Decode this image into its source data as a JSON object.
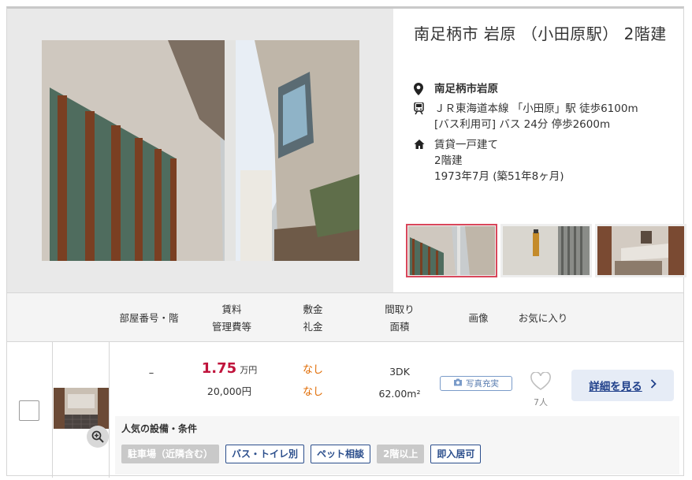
{
  "listing": {
    "title": "南足柄市 岩原 （小田原駅） 2階建",
    "address": "南足柄市岩原",
    "access": [
      "ＪＲ東海道本線 「小田原」駅 徒歩6100m",
      "[バス利用可] バス 24分 停歩2600m"
    ],
    "building": [
      "賃貸一戸建て",
      "2階建",
      "1973年7月 (築51年8ヶ月)"
    ],
    "icons": {
      "address": "map-pin-icon",
      "access": "train-icon",
      "building": "house-icon"
    }
  },
  "table_header": {
    "room": "部屋番号・階",
    "rent": "賃料",
    "mgmt": "管理費等",
    "deposit": "敷金",
    "key_money": "礼金",
    "layout": "間取り",
    "area": "面積",
    "image": "画像",
    "favorite": "お気に入り"
  },
  "room": {
    "number": "–",
    "rent": "1.75",
    "rent_unit": "万円",
    "mgmt_fee": "20,000円",
    "deposit": "なし",
    "key_money": "なし",
    "layout": "3DK",
    "area": "62.00m²",
    "photo_badge": "写真充実",
    "favorite_count": "7人",
    "detail_button": "詳細を見る",
    "features_title": "人気の設備・条件",
    "features": [
      {
        "label": "駐車場（近隣含む）",
        "active": false
      },
      {
        "label": "バス・トイレ別",
        "active": true
      },
      {
        "label": "ペット相談",
        "active": true
      },
      {
        "label": "2階以上",
        "active": false
      },
      {
        "label": "即入居可",
        "active": true
      }
    ]
  },
  "colors": {
    "price": "#c0143c",
    "deposit": "#e06a00",
    "link": "#1f3f8a",
    "selected_thumb": "#d9475b"
  }
}
